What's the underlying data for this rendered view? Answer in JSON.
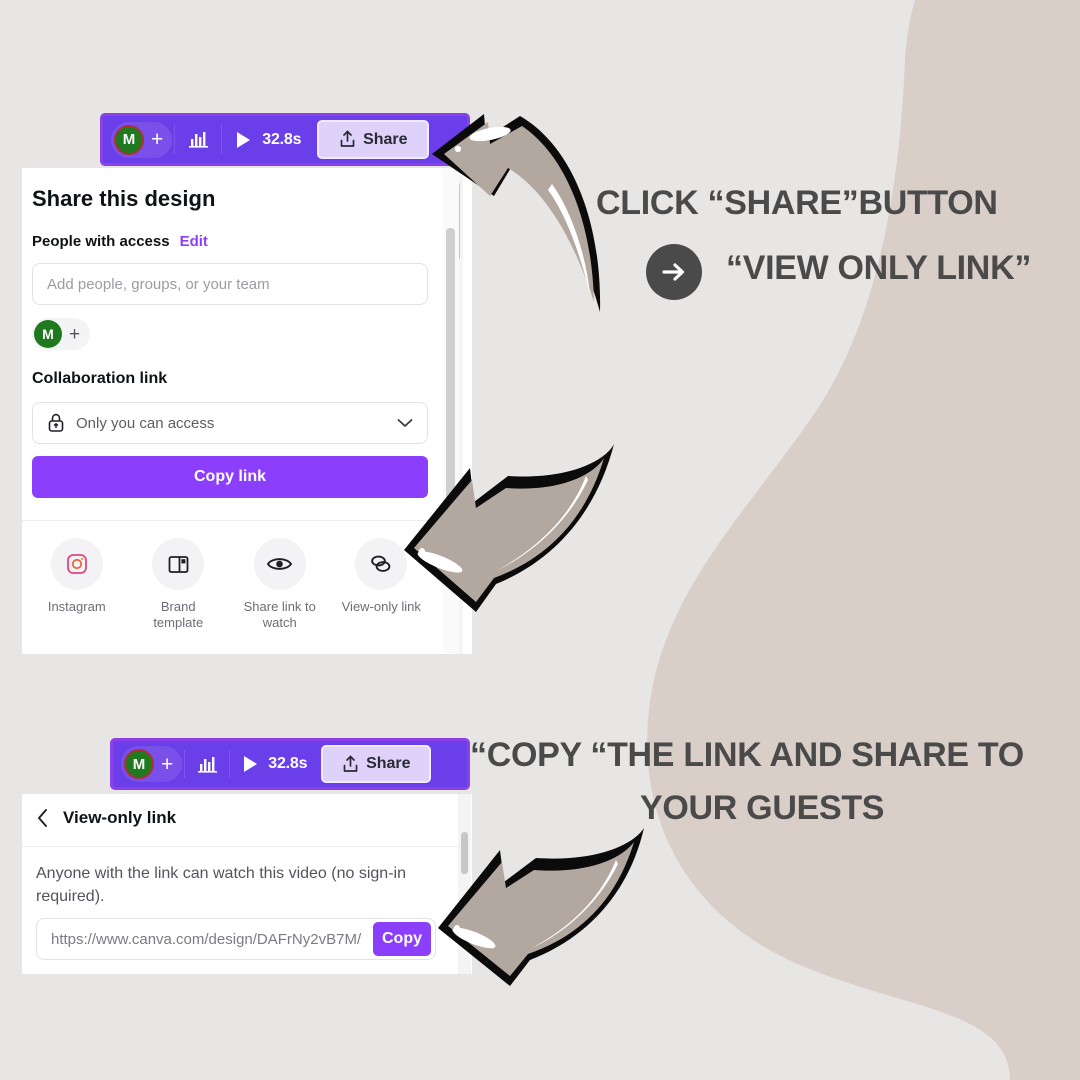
{
  "canvas": {
    "background_color": "#e8e6e4",
    "blob_color": "#d9cec8"
  },
  "toolbar": {
    "avatar_initial": "M",
    "add_person_label": "+",
    "stats_icon": "bar-chart-icon",
    "play_icon": "play-icon",
    "duration": "32.8s",
    "share_label": "Share",
    "share_icon": "upload-share-icon",
    "background_color": "#6a3ee8",
    "share_button_color": "#ded2fb"
  },
  "share_panel": {
    "title": "Share this design",
    "people_label": "People with access",
    "edit_label": "Edit",
    "people_input_placeholder": "Add people, groups, or your team",
    "avatar_initial": "M",
    "avatar_add_label": "+",
    "collaboration_label": "Collaboration link",
    "access_value": "Only you can access",
    "access_icon": "lock-icon",
    "chevron_icon": "chevron-down-icon",
    "copy_link_label": "Copy link",
    "accent_color": "#8b3ffd",
    "share_options": [
      {
        "icon": "instagram-icon",
        "label": "Instagram"
      },
      {
        "icon": "brand-template-icon",
        "label": "Brand\ntemplate"
      },
      {
        "icon": "eye-icon",
        "label": "Share link to\nwatch"
      },
      {
        "icon": "link-chain-icon",
        "label": "View-only link"
      }
    ]
  },
  "view_only_panel": {
    "back_icon": "chevron-left-icon",
    "title": "View-only link",
    "description": "Anyone with the link can watch this video (no sign-in required).",
    "url": "https://www.canva.com/design/DAFrNy2vB7M/",
    "copy_label": "Copy",
    "accent_color": "#8b3ffd"
  },
  "captions": {
    "step1_line1": "CLICK “SHARE”BUTTON",
    "step1_arrow_icon": "arrow-right-circle-icon",
    "step1_line2": "“VIEW ONLY LINK”",
    "step2_line1": "“COPY “THE LINK AND SHARE TO",
    "step2_line2": "YOUR GUESTS",
    "text_color": "#4a4a4a"
  },
  "annotations": {
    "arrow1_name": "curved-arrow-to-share-button",
    "arrow2_name": "curved-arrow-to-view-only-link",
    "arrow3_name": "curved-arrow-to-copy-button",
    "arrow_fill": "#b3a89f",
    "arrow_outline": "#0b0b0b"
  }
}
